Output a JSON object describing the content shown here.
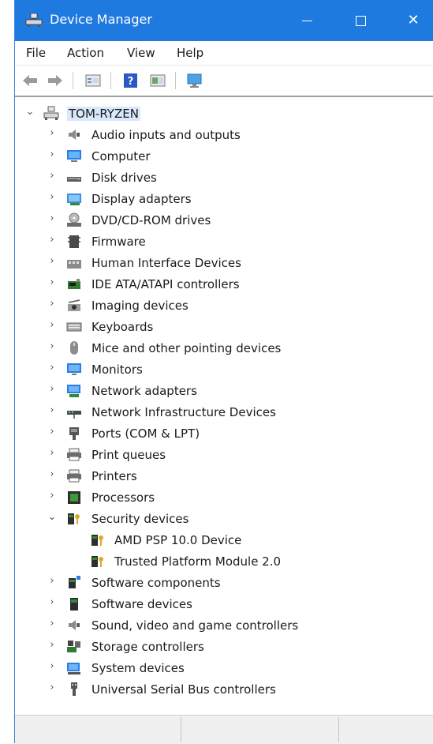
{
  "window": {
    "title": "Device Manager",
    "accent": "#1f7ae0"
  },
  "menu": {
    "file": "File",
    "action": "Action",
    "view": "View",
    "help": "Help"
  },
  "toolbar": [
    "back-icon",
    "forward-icon",
    "properties-icon",
    "help-icon",
    "update-driver-icon",
    "scan-hardware-icon"
  ],
  "tree": {
    "root": "TOM-RYZEN",
    "categories": [
      {
        "label": "Audio inputs and outputs",
        "icon": "speaker-icon",
        "expanded": false
      },
      {
        "label": "Computer",
        "icon": "computer-icon",
        "expanded": false
      },
      {
        "label": "Disk drives",
        "icon": "disk-drive-icon",
        "expanded": false
      },
      {
        "label": "Display adapters",
        "icon": "display-adapter-icon",
        "expanded": false
      },
      {
        "label": "DVD/CD-ROM drives",
        "icon": "dvd-drive-icon",
        "expanded": false
      },
      {
        "label": "Firmware",
        "icon": "firmware-icon",
        "expanded": false
      },
      {
        "label": "Human Interface Devices",
        "icon": "hid-icon",
        "expanded": false
      },
      {
        "label": "IDE ATA/ATAPI controllers",
        "icon": "ide-controller-icon",
        "expanded": false
      },
      {
        "label": "Imaging devices",
        "icon": "camera-icon",
        "expanded": false
      },
      {
        "label": "Keyboards",
        "icon": "keyboard-icon",
        "expanded": false
      },
      {
        "label": "Mice and other pointing devices",
        "icon": "mouse-icon",
        "expanded": false
      },
      {
        "label": "Monitors",
        "icon": "monitor-icon",
        "expanded": false
      },
      {
        "label": "Network adapters",
        "icon": "network-adapter-icon",
        "expanded": false
      },
      {
        "label": "Network Infrastructure Devices",
        "icon": "network-infrastructure-icon",
        "expanded": false
      },
      {
        "label": "Ports (COM & LPT)",
        "icon": "port-icon",
        "expanded": false
      },
      {
        "label": "Print queues",
        "icon": "printer-icon",
        "expanded": false
      },
      {
        "label": "Printers",
        "icon": "printer-icon",
        "expanded": false
      },
      {
        "label": "Processors",
        "icon": "processor-icon",
        "expanded": false
      },
      {
        "label": "Security devices",
        "icon": "security-device-icon",
        "expanded": true,
        "children": [
          {
            "label": "AMD PSP 10.0 Device",
            "icon": "security-device-icon"
          },
          {
            "label": "Trusted Platform Module 2.0",
            "icon": "security-device-icon"
          }
        ]
      },
      {
        "label": "Software components",
        "icon": "software-component-icon",
        "expanded": false
      },
      {
        "label": "Software devices",
        "icon": "software-device-icon",
        "expanded": false
      },
      {
        "label": "Sound, video and game controllers",
        "icon": "speaker-icon",
        "expanded": false
      },
      {
        "label": "Storage controllers",
        "icon": "storage-controller-icon",
        "expanded": false
      },
      {
        "label": "System devices",
        "icon": "system-devices-icon",
        "expanded": false
      },
      {
        "label": "Universal Serial Bus controllers",
        "icon": "usb-icon",
        "expanded": false
      }
    ]
  }
}
